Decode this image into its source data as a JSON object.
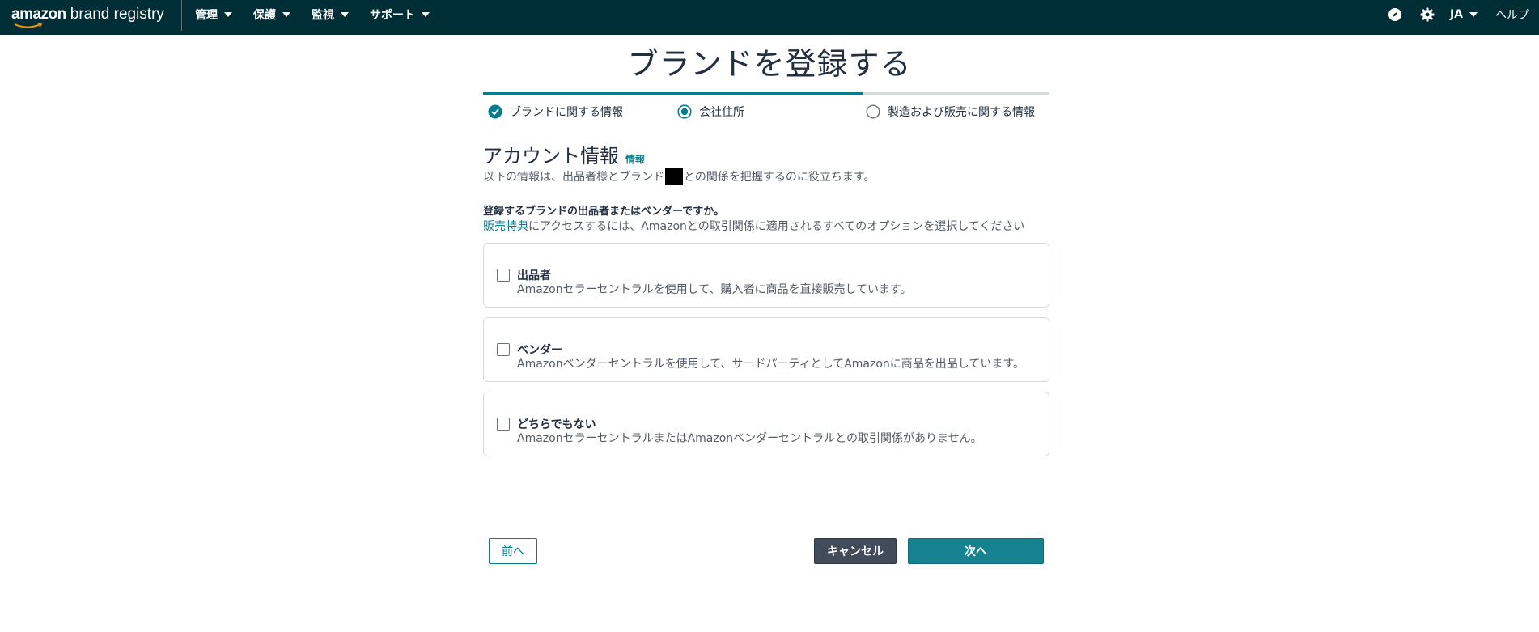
{
  "nav": {
    "logo_brand": "amazon",
    "logo_product": "brand registry",
    "menu": [
      {
        "label": "管理"
      },
      {
        "label": "保護"
      },
      {
        "label": "監視"
      },
      {
        "label": "サポート"
      }
    ],
    "language": "JA",
    "help": "ヘルプ",
    "icons": [
      "compass-icon",
      "gear-icon"
    ],
    "background_color": "#002e36"
  },
  "page": {
    "title": "ブランドを登録する"
  },
  "progress": {
    "completed_fraction": 0.67,
    "steps": [
      {
        "label": "ブランドに関する情報",
        "state": "completed"
      },
      {
        "label": "会社住所",
        "state": "current"
      },
      {
        "label": "製造および販売に関する情報",
        "state": "pending"
      }
    ],
    "accent_color": "#067d8f"
  },
  "section": {
    "title": "アカウント情報",
    "info_link": "情報",
    "description_before": "以下の情報は、出品者様とブランド",
    "description_after": "との関係を把握するのに役立ちます。"
  },
  "question": {
    "label": "登録するブランドの出品者またはベンダーですか。",
    "hint_link": "販売特典",
    "hint_text": "にアクセスするには、Amazonとの取引関係に適用されるすべてのオプションを選択してください"
  },
  "options": [
    {
      "title": "出品者",
      "description": "Amazonセラーセントラルを使用して、購入者に商品を直接販売しています。",
      "checked": false
    },
    {
      "title": "ベンダー",
      "description": "Amazonベンダーセントラルを使用して、サードパーティとしてAmazonに商品を出品しています。",
      "checked": false
    },
    {
      "title": "どちらでもない",
      "description": "AmazonセラーセントラルまたはAmazonベンダーセントラルとの取引関係がありません。",
      "checked": false
    }
  ],
  "buttons": {
    "previous": "前へ",
    "cancel": "キャンセル",
    "next": "次へ"
  }
}
